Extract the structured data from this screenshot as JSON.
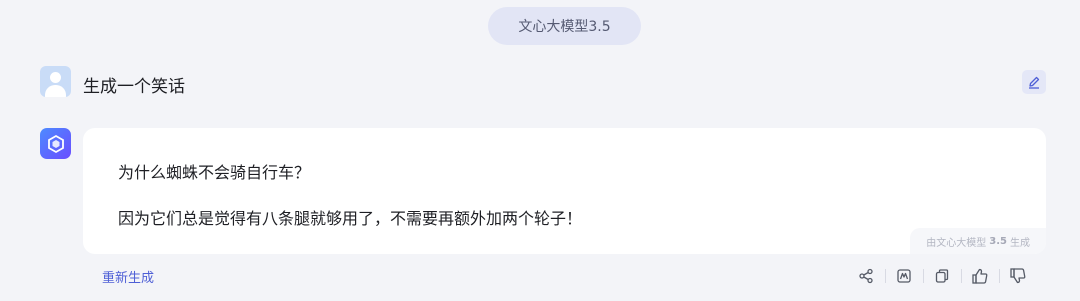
{
  "model_pill": {
    "label": "文心大模型3.5"
  },
  "user_message": {
    "text": "生成一个笑话"
  },
  "answer": {
    "lines": [
      "为什么蜘蛛不会骑自行车？",
      "因为它们总是觉得有八条腿就够用了，不需要再额外加两个轮子！"
    ],
    "gen_note": {
      "prefix": "由文心大模型",
      "version": "3.5",
      "suffix": "生成"
    }
  },
  "footer": {
    "regenerate_label": "重新生成"
  },
  "icons": {
    "edit": "edit-pencil-icon",
    "share": "share-icon",
    "mindmap": "mindmap-icon",
    "copy": "copy-icon",
    "like": "thumbs-up-icon",
    "dislike": "thumbs-down-icon"
  },
  "colors": {
    "accent": "#4e5fd6",
    "background": "#f3f4f8",
    "pill": "#e2e5f5"
  }
}
